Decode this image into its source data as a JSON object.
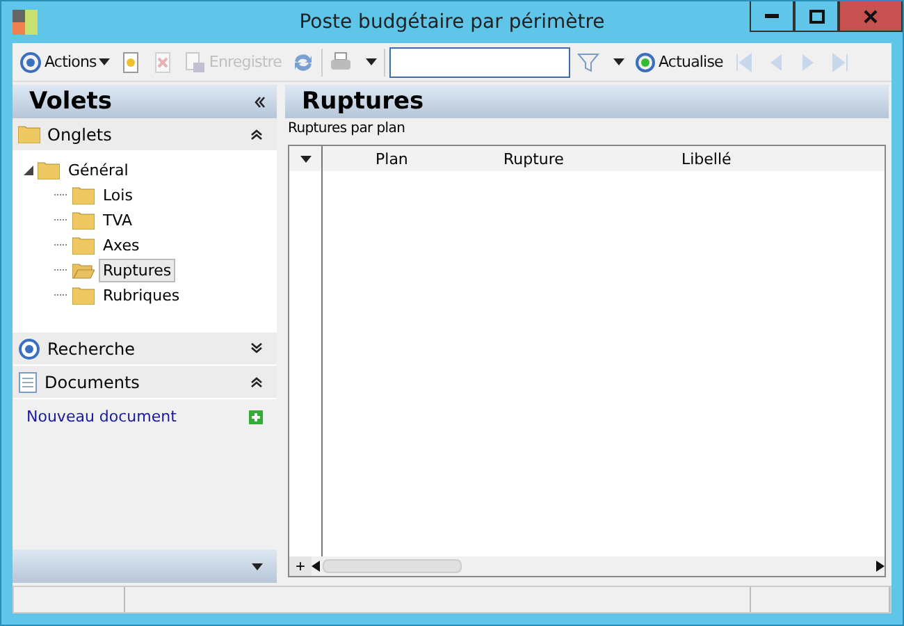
{
  "window": {
    "title": "Poste budgétaire par périmètre"
  },
  "toolbar": [
    {
      "kind": "menu",
      "label": "Actions",
      "disabled": false
    },
    {
      "kind": "icon"
    },
    {
      "kind": "icon",
      "disabled": true
    },
    {
      "kind": "text",
      "label": "Enregistre",
      "disabled": true
    },
    {
      "kind": "icon"
    },
    {
      "kind": "print"
    },
    {
      "kind": "field"
    },
    {
      "kind": "filter"
    },
    {
      "kind": "text",
      "label": "Actualise",
      "disabled": false
    },
    {
      "kind": "icon",
      "disabled": true
    },
    {
      "kind": "icon",
      "disabled": true
    },
    {
      "kind": "icon",
      "disabled": true
    },
    {
      "kind": "icon",
      "disabled": true
    }
  ],
  "sidebar": {
    "title": "Volets",
    "sections": [
      {
        "kind": "tree",
        "title": "Onglets",
        "expanded": true,
        "tree": [
          {
            "label": "Général",
            "expanded": true,
            "selected": false,
            "children": [
              {
                "label": "Lois",
                "selected": false
              },
              {
                "label": "TVA",
                "selected": false
              },
              {
                "label": "Axes",
                "selected": false
              },
              {
                "label": "Ruptures",
                "selected": true
              },
              {
                "label": "Rubriques",
                "selected": false
              }
            ]
          }
        ]
      },
      {
        "kind": "search",
        "title": "Recherche",
        "expanded": false
      },
      {
        "kind": "links",
        "title": "Documents",
        "expanded": true,
        "links": [
          "Nouveau document"
        ]
      }
    ]
  },
  "main": {
    "title": "Ruptures",
    "group": "Ruptures par plan",
    "table": {
      "columns": [
        "Plan",
        "Rupture",
        "Libellé"
      ],
      "add_row": "+"
    }
  }
}
